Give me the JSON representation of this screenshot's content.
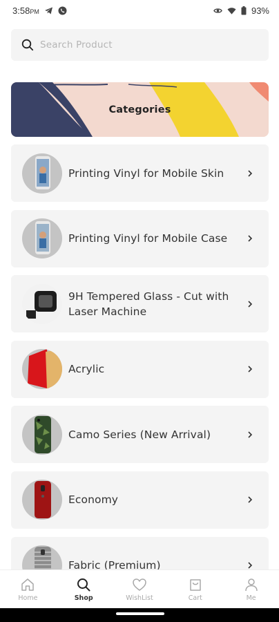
{
  "status_bar": {
    "time": "3:58",
    "ampm": "PM",
    "battery": "93%"
  },
  "search": {
    "placeholder": "Search Product",
    "value": ""
  },
  "banner": {
    "title": "Categories"
  },
  "categories": [
    {
      "label": "Printing Vinyl for Mobile Skin",
      "icon": "phone-skin-thumbnail"
    },
    {
      "label": "Printing Vinyl for Mobile Case",
      "icon": "phone-case-thumbnail"
    },
    {
      "label": "9H Tempered Glass - Cut with Laser Machine",
      "icon": "laser-machine-thumbnail"
    },
    {
      "label": "Acrylic",
      "icon": "acrylic-sheets-thumbnail"
    },
    {
      "label": "Camo Series (New Arrival)",
      "icon": "camo-phone-thumbnail"
    },
    {
      "label": "Economy",
      "icon": "red-phone-thumbnail"
    },
    {
      "label": "Fabric (Premium)",
      "icon": "fabric-phone-thumbnail"
    }
  ],
  "bottom_nav": [
    {
      "label": "Home",
      "icon": "home-icon",
      "active": false
    },
    {
      "label": "Shop",
      "icon": "search-icon",
      "active": true
    },
    {
      "label": "WishList",
      "icon": "heart-icon",
      "active": false
    },
    {
      "label": "Cart",
      "icon": "shopping-bag-icon",
      "active": false
    },
    {
      "label": "Me",
      "icon": "user-icon",
      "active": false
    }
  ],
  "colors": {
    "card_bg": "#f4f4f4",
    "banner_navy": "#3a4266",
    "banner_yellow": "#f3d330",
    "banner_peach": "#f3d9cf",
    "banner_coral": "#f08a72"
  }
}
